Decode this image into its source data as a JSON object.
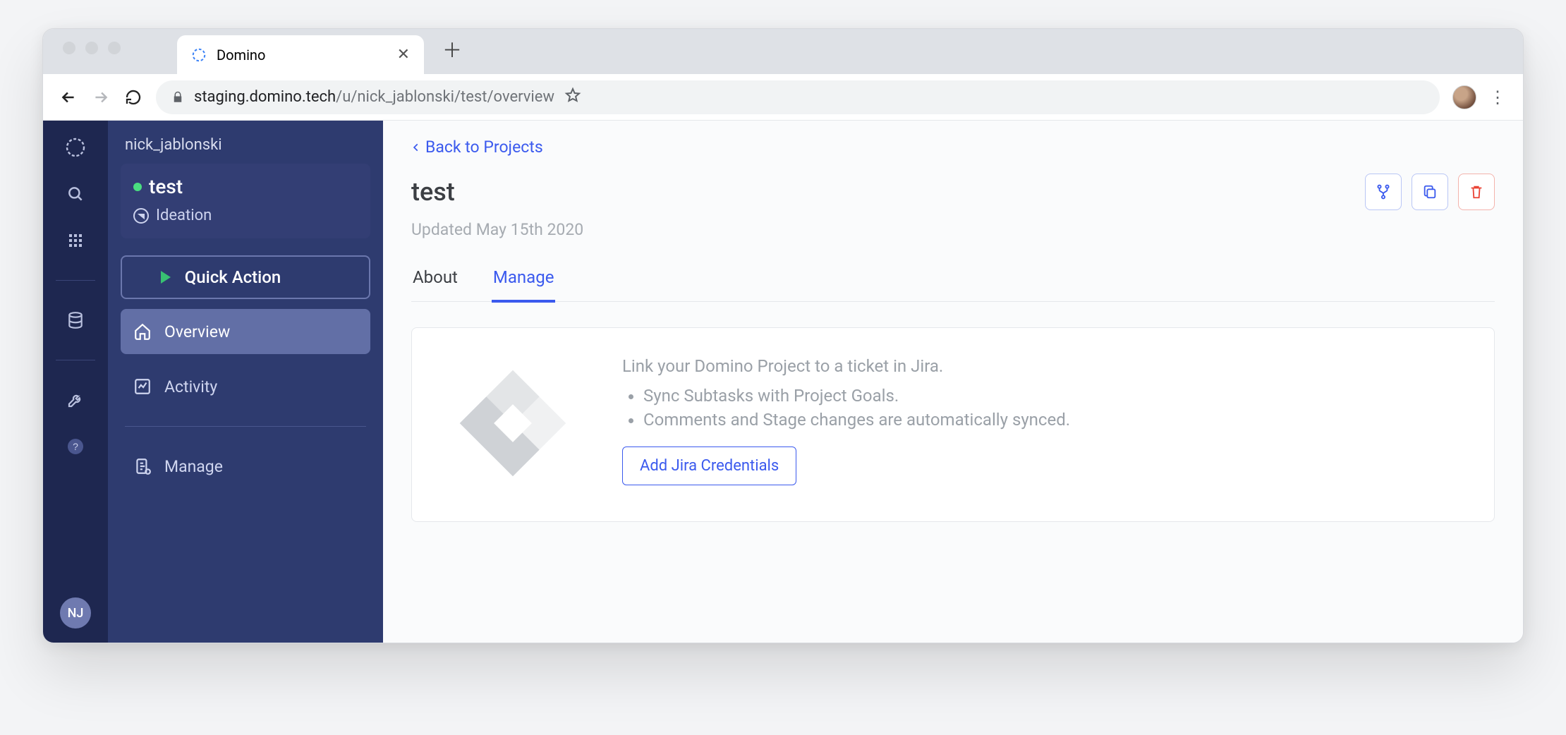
{
  "browser": {
    "tab_title": "Domino",
    "url_host": "staging.domino.tech",
    "url_path": "/u/nick_jablonski/test/overview"
  },
  "rail": {
    "user_initials": "NJ"
  },
  "sidebar": {
    "owner": "nick_jablonski",
    "project_name": "test",
    "project_stage": "Ideation",
    "quick_action_label": "Quick Action",
    "links": {
      "overview": "Overview",
      "activity": "Activity",
      "manage": "Manage"
    }
  },
  "main": {
    "back_label": "Back to Projects",
    "title": "test",
    "updated": "Updated May 15th 2020",
    "tabs": {
      "about": "About",
      "manage": "Manage"
    },
    "jira": {
      "heading": "Link your Domino Project to a ticket in Jira.",
      "bullets": [
        "Sync Subtasks with Project Goals.",
        "Comments and Stage changes are automatically synced."
      ],
      "button": "Add Jira Credentials"
    }
  }
}
